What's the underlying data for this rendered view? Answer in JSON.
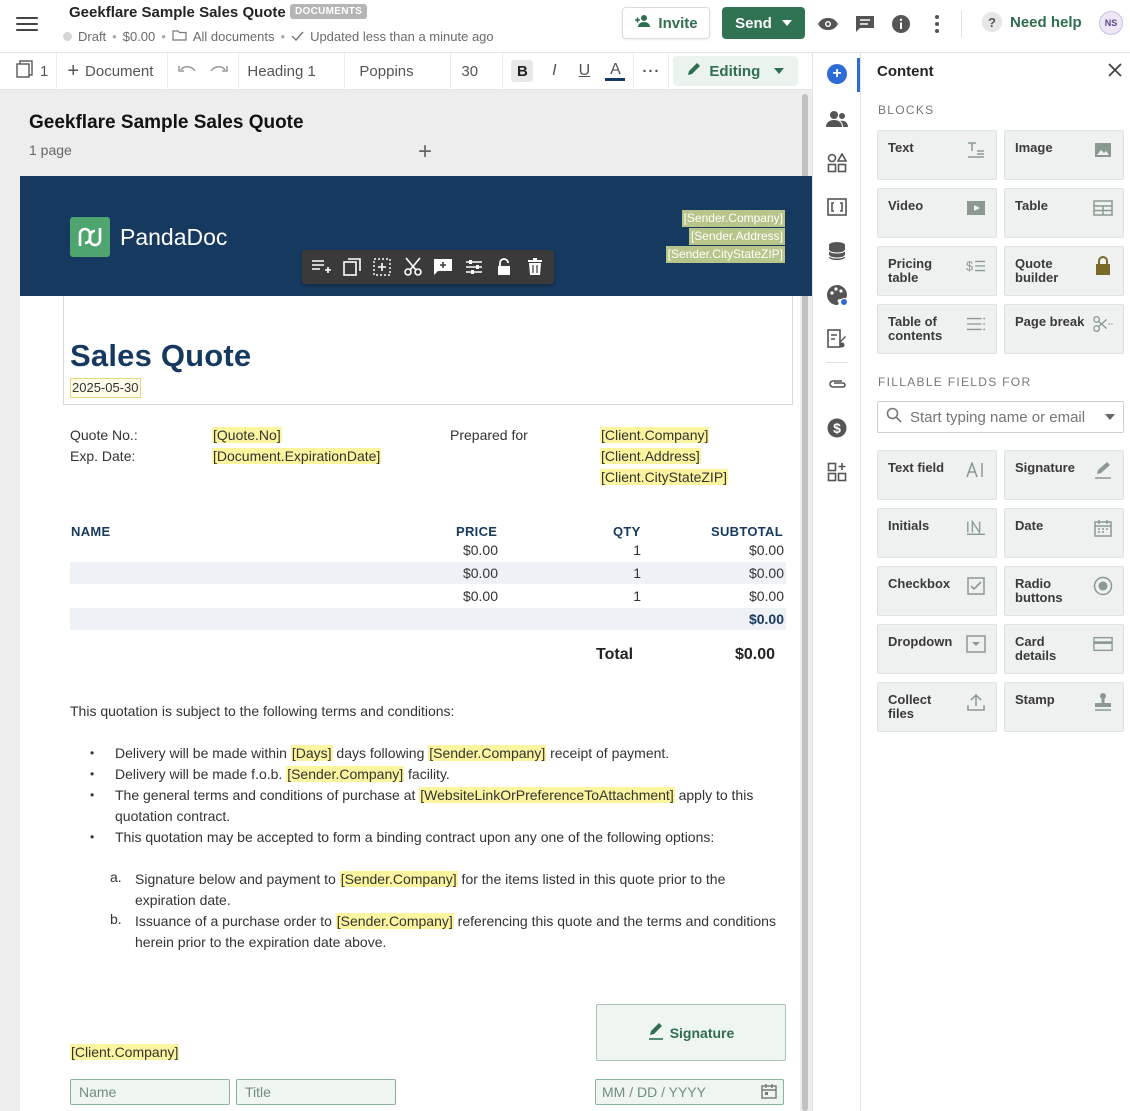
{
  "header": {
    "title": "Geekflare Sample Sales Quote",
    "badge": "DOCUMENTS",
    "status": "Draft",
    "amount": "$0.00",
    "folder": "All documents",
    "updated": "Updated less than a minute ago",
    "invite_label": "Invite",
    "send_label": "Send",
    "help_label": "Need help",
    "avatar_initials": "NS"
  },
  "toolbar": {
    "page_count": "1",
    "add_label": "Document",
    "style_value": "Heading 1",
    "font_value": "Poppins",
    "size_value": "30",
    "bold_label": "B",
    "italic_label": "I",
    "underline_label": "U",
    "color_label": "A",
    "more_label": "···",
    "mode_label": "Editing"
  },
  "doc_meta": {
    "title": "Geekflare Sample Sales Quote",
    "pages": "1 page"
  },
  "document": {
    "logo_text": "PandaDoc",
    "sender_company": "[Sender.Company]",
    "sender_address": "[Sender.Address]",
    "sender_city": "[Sender.CityStateZIP]",
    "heading": "Sales Quote",
    "date": "2025-05-30",
    "quote_no_label": "Quote No.:",
    "quote_no_value": "[Quote.No]",
    "exp_label": "Exp. Date:",
    "exp_value": "[Document.ExpirationDate]",
    "prepared_label": "Prepared for",
    "client_company": "[Client.Company]",
    "client_address": "[Client.Address]",
    "client_city": "[Client.CityStateZIP]",
    "table": {
      "headers": [
        "NAME",
        "PRICE",
        "QTY",
        "SUBTOTAL"
      ],
      "rows": [
        {
          "price": "$0.00",
          "qty": "1",
          "subtotal": "$0.00"
        },
        {
          "price": "$0.00",
          "qty": "1",
          "subtotal": "$0.00"
        },
        {
          "price": "$0.00",
          "qty": "1",
          "subtotal": "$0.00"
        }
      ],
      "sum": "$0.00",
      "total_label": "Total",
      "total_value": "$0.00"
    },
    "terms_intro": "This quotation is subject to the following terms and conditions:",
    "terms": {
      "t1a": "Delivery will be made within ",
      "t1_days": "[Days]",
      "t1b": " days following ",
      "t1_company": "[Sender.Company]",
      "t1c": " receipt of payment.",
      "t2a": "Delivery will be made f.o.b. ",
      "t2_company": "[Sender.Company]",
      "t2b": " facility.",
      "t3a": "The general terms and conditions of purchase at ",
      "t3_link": "[WebsiteLinkOrPreferenceToAttachment]",
      "t3b": " apply to this",
      "t3c": "quotation contract.",
      "t4": "This quotation may be accepted to form a binding contract upon any one of the following options:",
      "a_marker": "a.",
      "a1": "Signature below and payment to ",
      "a_company": "[Sender.Company]",
      "a2": " for the items listed in this quote prior to the",
      "a3": "expiration date.",
      "b_marker": "b.",
      "b1": "Issuance of a purchase order to ",
      "b_company": "[Sender.Company]",
      "b2": " referencing this quote and the terms and conditions",
      "b3": "herein prior to the expiration date above."
    },
    "sign_client": "[Client.Company]",
    "signature_label": "Signature",
    "name_placeholder": "Name",
    "title_placeholder": "Title",
    "date_placeholder": "MM / DD / YYYY"
  },
  "panel": {
    "title": "Content",
    "blocks_label": "BLOCKS",
    "blocks": [
      "Text",
      "Image",
      "Video",
      "Table",
      "Pricing table",
      "Quote builder",
      "Table of contents",
      "Page break"
    ],
    "fields_label": "FILLABLE FIELDS FOR",
    "search_placeholder": "Start typing name or email",
    "fields": [
      "Text field",
      "Signature",
      "Initials",
      "Date",
      "Checkbox",
      "Radio buttons",
      "Dropdown",
      "Card details",
      "Collect files",
      "Stamp"
    ]
  },
  "colors": {
    "brand_green": "#2f7352",
    "banner_navy": "#163a5f",
    "highlight": "#fbf59f",
    "active_blue": "#2d6bd6"
  }
}
